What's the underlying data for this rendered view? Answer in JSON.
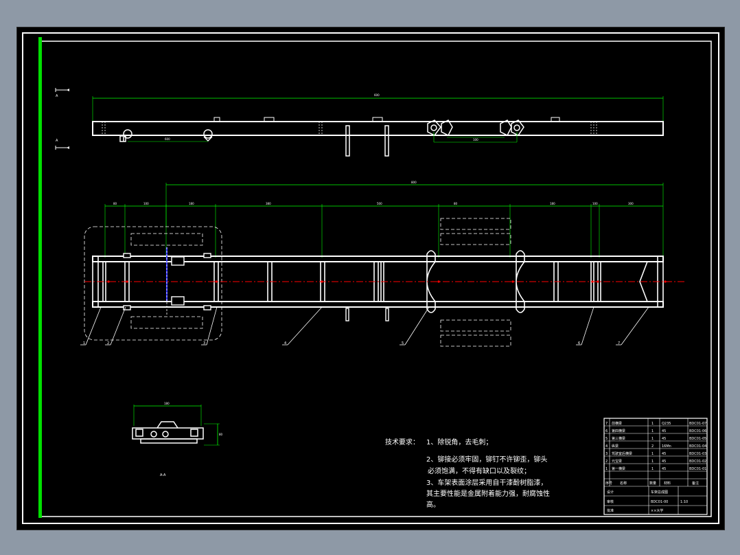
{
  "section_markers": {
    "top_label": "A",
    "bottom_label": "A",
    "section_view_label": "A-A"
  },
  "dimensions": {
    "side_view_overall": "600",
    "side_view_left_axle": "600",
    "side_view_rear_axle": "100",
    "plan_overall": "800",
    "plan_segments": [
      "80",
      "100",
      "180",
      "380",
      "500",
      "80",
      "180",
      "100",
      "300"
    ],
    "section_width": "180",
    "section_height": "80"
  },
  "part_callouts": [
    "1",
    "2",
    "3",
    "4",
    "5",
    "6",
    "7"
  ],
  "technical_requirements": {
    "heading": "技术要求：",
    "item1": "1、除锐角，去毛刺；",
    "item2_line1": "2、铆接必须牢固，铆钉不许铆歪，铆头",
    "item2_line2": "必须饱满，不得有缺口以及裂纹；",
    "item3_line1": "3、车架表面涂层采用自干漆酚树脂漆，",
    "item3_line2": "其主要性能是金属附着能力强，耐腐蚀性",
    "item3_line3": "高。"
  },
  "bom": {
    "rows": [
      {
        "no": "7",
        "name": "前横梁",
        "qty": "1",
        "material": "Q235",
        "code": "BDC01-07"
      },
      {
        "no": "6",
        "name": "第四横梁",
        "qty": "1",
        "material": "45",
        "code": "BDC01-06"
      },
      {
        "no": "5",
        "name": "第三横梁",
        "qty": "1",
        "material": "45",
        "code": "BDC01-05"
      },
      {
        "no": "4",
        "name": "纵梁",
        "qty": "2",
        "material": "16Mn",
        "code": "BDC01-04"
      },
      {
        "no": "3",
        "name": "驾驶室后横梁",
        "qty": "1",
        "material": "45",
        "code": "BDC01-03"
      },
      {
        "no": "2",
        "name": "元宝梁",
        "qty": "1",
        "material": "45",
        "code": "BDC01-02"
      },
      {
        "no": "1",
        "name": "第一横梁",
        "qty": "1",
        "material": "45",
        "code": "BDC01-01"
      }
    ],
    "header": {
      "no": "序号",
      "name": "名称",
      "qty": "数量",
      "material": "材料",
      "code": "备注"
    },
    "title_block": {
      "drawing_name": "车架总成图",
      "drawing_code": "BDC01-00",
      "scale": "1:10",
      "designer": "设计",
      "checker": "审核",
      "approver": "批准",
      "school": "××大学"
    }
  },
  "colors": {
    "background": "#000000",
    "frame": "#ffffff",
    "dimension": "#00ff00",
    "centerline": "#ff0000",
    "hidden": "#ffffff",
    "accent": "#0000ff"
  }
}
